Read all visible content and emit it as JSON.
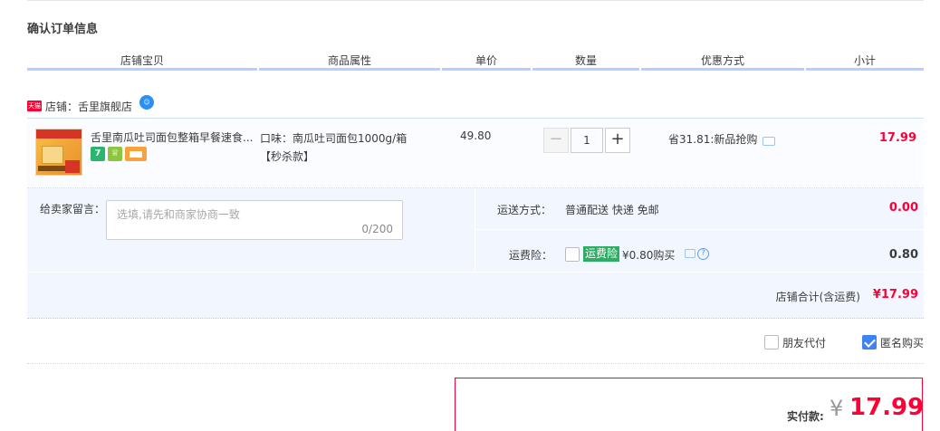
{
  "page": {
    "title": "确认订单信息"
  },
  "table_headers": [
    "店铺宝贝",
    "商品属性",
    "单价",
    "数量",
    "优惠方式",
    "小计"
  ],
  "shop": {
    "tmall_badge": "天猫",
    "label": "店铺：舌里旗舰店",
    "chat_icon": "chat-bubble-icon"
  },
  "item": {
    "title": "舌里南瓜吐司面包整箱早餐速食...",
    "sku_line1": "口味：南瓜吐司面包1000g/箱",
    "sku_line2": "【秒杀款】",
    "price": "49.80",
    "quantity": "1",
    "minus": "−",
    "plus": "+",
    "promo": "省31.81:新品抢购",
    "subtotal": "17.99",
    "badge_7": "7"
  },
  "extra": {
    "message_label": "给卖家留言：",
    "message_placeholder": "选填,请先和商家协商一致",
    "message_count": "0/200",
    "shipping_label": "运送方式：",
    "shipping_value": "普通配送 快递 免邮",
    "shipping_fee": "0.00",
    "insurance_label": "运费险：",
    "insurance_tag": "运费险",
    "insurance_price": "¥0.80购买",
    "insurance_fee": "0.80",
    "shop_total_label": "店铺合计(含运费)",
    "shop_total_value": "¥17.99"
  },
  "options": {
    "friend_pay": "朋友代付",
    "friend_pay_checked": false,
    "anonymous": "匿名购买",
    "anonymous_checked": true
  },
  "payment": {
    "label": "实付款:",
    "currency": "¥",
    "amount": "17.99"
  },
  "colors": {
    "accent_red": "#ff0036",
    "header_blue": "#b2d1ff",
    "check_blue": "#3e84f0",
    "insurance_green": "#2fac63"
  }
}
